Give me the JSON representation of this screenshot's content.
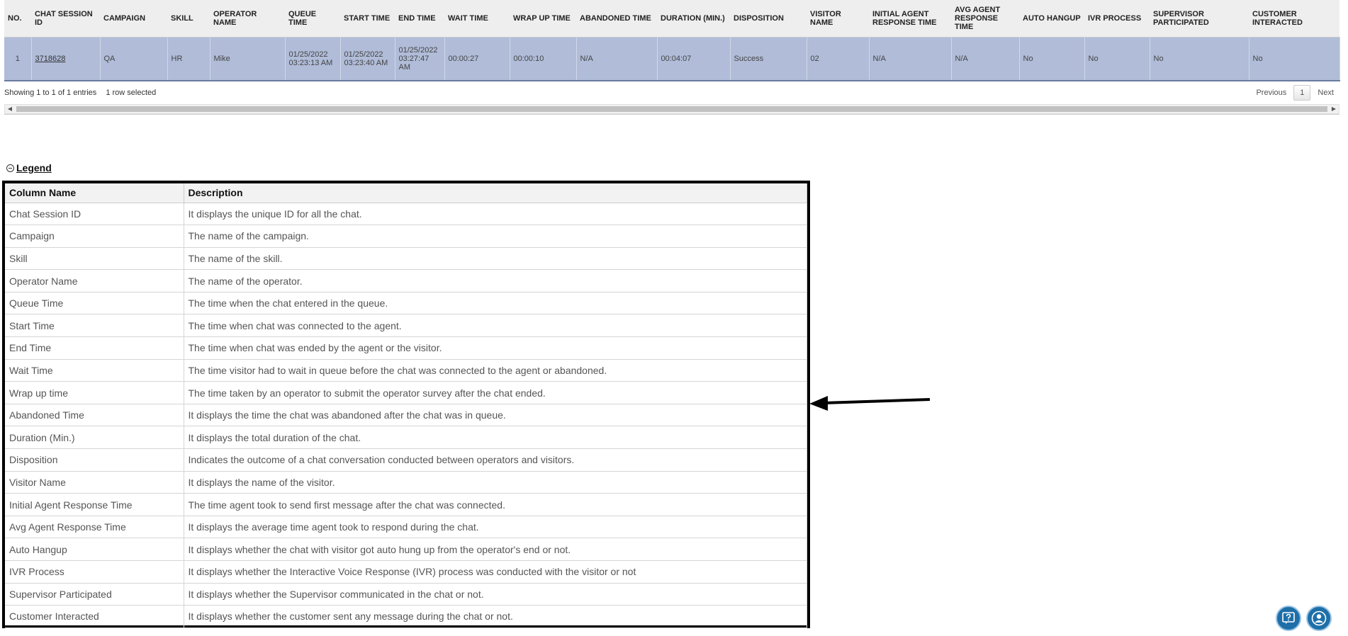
{
  "report": {
    "columns": [
      "No.",
      "Chat Session ID",
      "Campaign",
      "Skill",
      "Operator Name",
      "Queue Time",
      "Start Time",
      "End Time",
      "Wait Time",
      "Wrap Up Time",
      "Abandoned Time",
      "Duration (Min.)",
      "Disposition",
      "Visitor Name",
      "Initial Agent Response Time",
      "Avg Agent Response Time",
      "Auto Hangup",
      "IVR Process",
      "Supervisor Participated",
      "Customer Interacted"
    ],
    "rows": [
      [
        "1",
        "3718628",
        "QA",
        "HR",
        "Mike",
        "01/25/2022 03:23:13 AM",
        "01/25/2022 03:23:40 AM",
        "01/25/2022 03:27:47 AM",
        "00:00:27",
        "00:00:10",
        "N/A",
        "00:04:07",
        "Success",
        "02",
        "N/A",
        "N/A",
        "No",
        "No",
        "No",
        "No"
      ]
    ],
    "info": "Showing 1 to 1 of 1 entries",
    "selected_info": "1 row selected",
    "pager": {
      "previous": "Previous",
      "page": "1",
      "next": "Next"
    }
  },
  "legend": {
    "toggle_label": "Legend",
    "headers": [
      "Column Name",
      "Description"
    ],
    "rows": [
      [
        "Chat Session ID",
        "It displays the unique ID for all the chat."
      ],
      [
        "Campaign",
        "The name of the campaign."
      ],
      [
        "Skill",
        "The name of the skill."
      ],
      [
        "Operator Name",
        "The name of the operator."
      ],
      [
        "Queue Time",
        "The time when the chat entered in the queue."
      ],
      [
        "Start Time",
        "The time when chat was connected to the agent."
      ],
      [
        "End Time",
        "The time when chat was ended by the agent or the visitor."
      ],
      [
        "Wait Time",
        "The time visitor had to wait in queue before the chat was connected to the agent or abandoned."
      ],
      [
        "Wrap up time",
        "The time taken by an operator to submit the operator survey after the chat ended."
      ],
      [
        "Abandoned Time",
        "It displays the time the chat was abandoned after the chat was in queue."
      ],
      [
        "Duration (Min.)",
        "It displays the total duration of the chat."
      ],
      [
        "Disposition",
        "Indicates the outcome of a chat conversation conducted between operators and visitors."
      ],
      [
        "Visitor Name",
        "It displays the name of the visitor."
      ],
      [
        "Initial Agent Response Time",
        "The time agent took to send first message after the chat was connected."
      ],
      [
        "Avg Agent Response Time",
        "It displays the average time agent took to respond during the chat."
      ],
      [
        "Auto Hangup",
        "It displays whether the chat with visitor got auto hung up from the operator's end or not."
      ],
      [
        "IVR Process",
        "It displays whether the Interactive Voice Response (IVR) process was conducted with the visitor or not"
      ],
      [
        "Supervisor Participated",
        "It displays whether the Supervisor communicated in the chat or not."
      ],
      [
        "Customer Interacted",
        "It displays whether the customer sent any message during the chat or not."
      ]
    ]
  },
  "icons": {
    "help": "help-icon",
    "profile": "user-profile-icon",
    "annotation": "arrow-left-icon"
  },
  "colors": {
    "selected_row": "#b0bcd8",
    "fab": "#1e6fa8"
  }
}
